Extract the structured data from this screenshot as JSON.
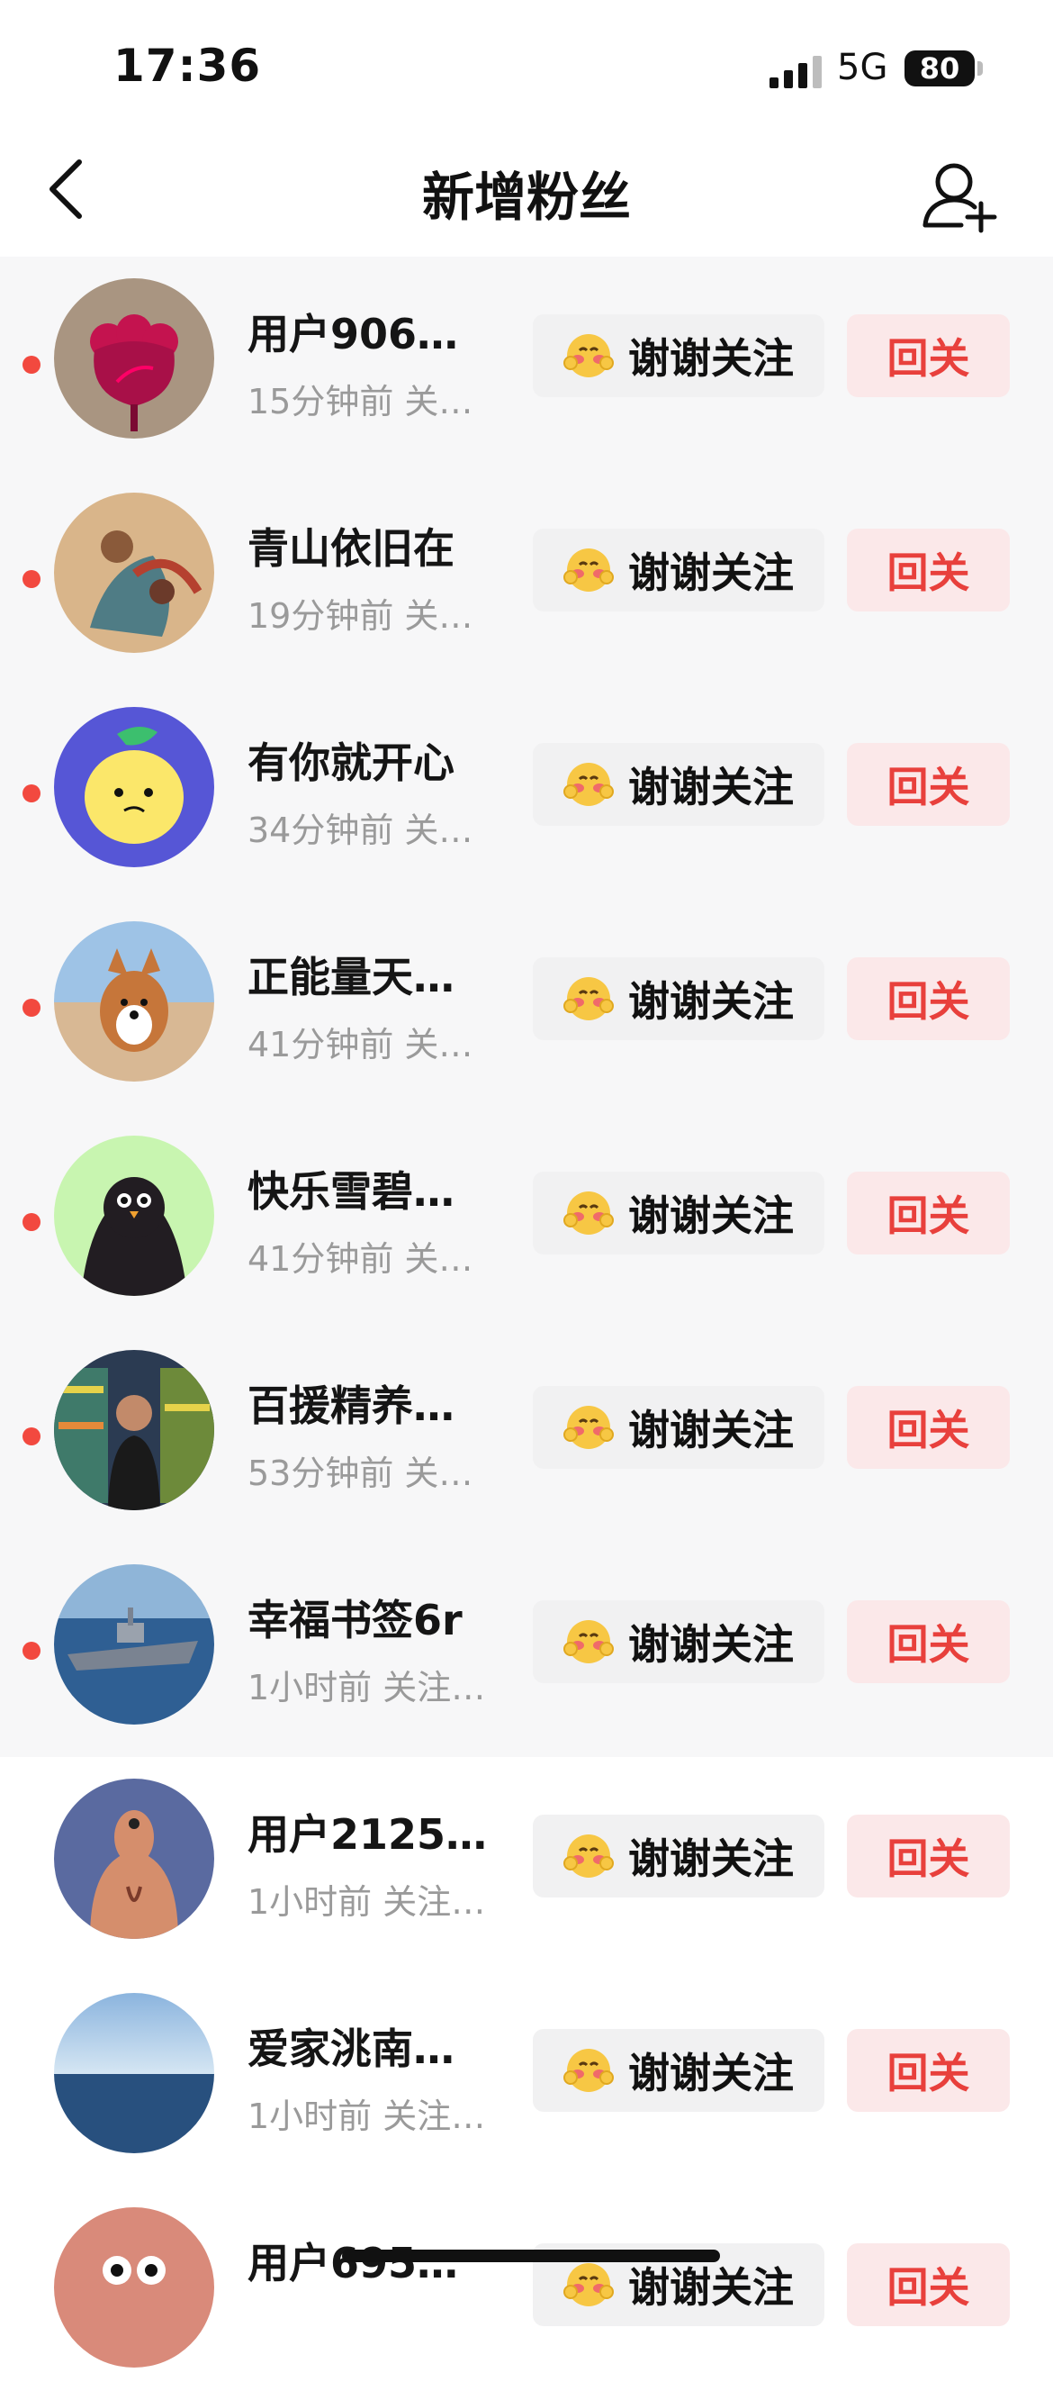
{
  "status": {
    "time": "17:36",
    "network": "5G",
    "battery": "80"
  },
  "nav": {
    "title": "新增粉丝"
  },
  "colors": {
    "accent": "#e8403c",
    "unread_dot": "#f2493f",
    "unread_bg": "#f7f7f8"
  },
  "icons": {
    "back": "chevron-left-icon",
    "add_user": "add-user-icon",
    "thanks": "blushing-emoji-icon"
  },
  "fans": [
    {
      "name": "用户906…",
      "sub": "15分钟前 关…",
      "thanks": "谢谢关注",
      "follow": "回关",
      "unread": true,
      "avatar": "flower"
    },
    {
      "name": "青山依旧在",
      "sub": "19分钟前 关…",
      "thanks": "谢谢关注",
      "follow": "回关",
      "unread": true,
      "avatar": "painting"
    },
    {
      "name": "有你就开心",
      "sub": "34分钟前 关…",
      "thanks": "谢谢关注",
      "follow": "回关",
      "unread": true,
      "avatar": "lemon"
    },
    {
      "name": "正能量天…",
      "sub": "41分钟前 关…",
      "thanks": "谢谢关注",
      "follow": "回关",
      "unread": true,
      "avatar": "dog"
    },
    {
      "name": "快乐雪碧…",
      "sub": "41分钟前 关…",
      "thanks": "谢谢关注",
      "follow": "回关",
      "unread": true,
      "avatar": "bird"
    },
    {
      "name": "百援精养…",
      "sub": "53分钟前 关…",
      "thanks": "谢谢关注",
      "follow": "回关",
      "unread": true,
      "avatar": "store"
    },
    {
      "name": "幸福书签6r",
      "sub": "1小时前 关注…",
      "thanks": "谢谢关注",
      "follow": "回关",
      "unread": true,
      "avatar": "ship"
    },
    {
      "name": "用户2125…",
      "sub": "1小时前 关注…",
      "thanks": "谢谢关注",
      "follow": "回关",
      "unread": false,
      "avatar": "creature"
    },
    {
      "name": "爱家洮南…",
      "sub": "1小时前 关注…",
      "thanks": "谢谢关注",
      "follow": "回关",
      "unread": false,
      "avatar": "sea"
    },
    {
      "name": "用户695…",
      "sub": "",
      "thanks": "谢谢关注",
      "follow": "回关",
      "unread": false,
      "avatar": "face"
    }
  ]
}
